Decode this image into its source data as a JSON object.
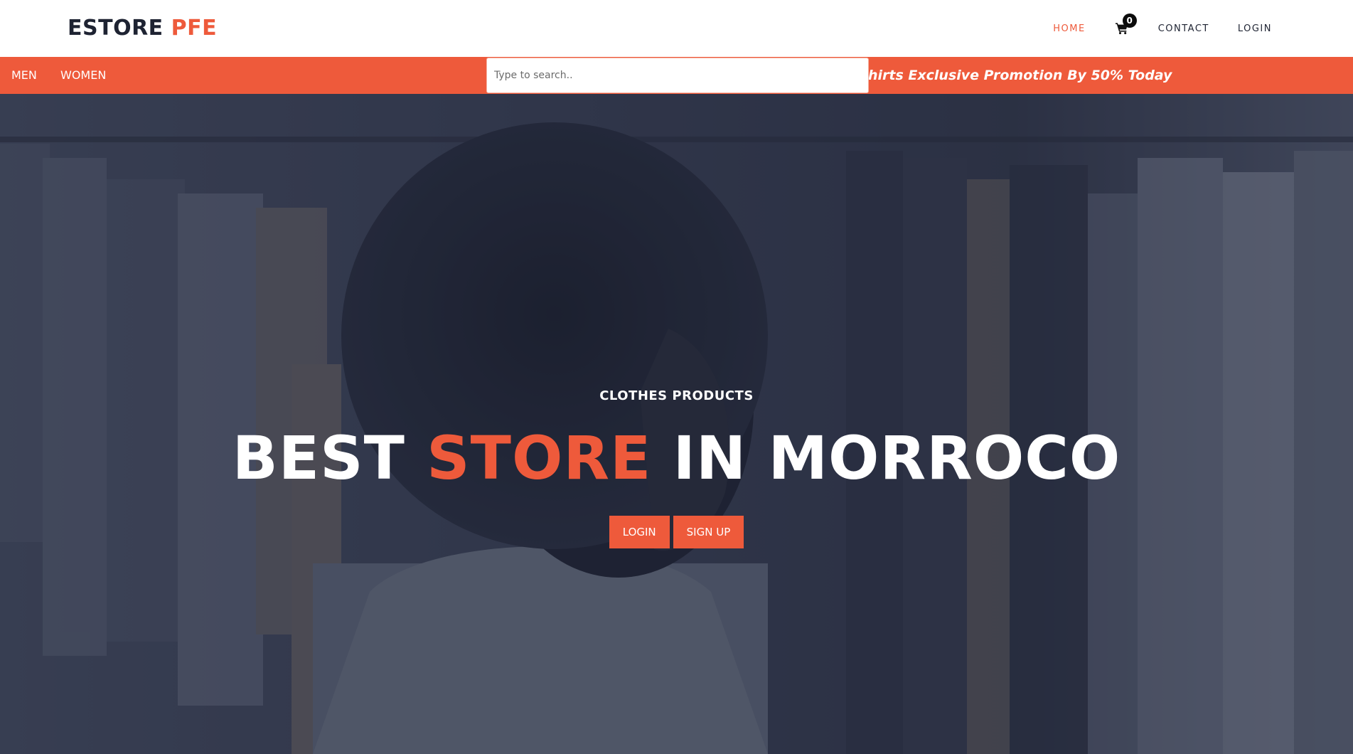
{
  "brand": {
    "name_part1": "ESTORE",
    "name_part2": "PFE",
    "accent_color": "#ee5a3b"
  },
  "nav": {
    "home": "HOME",
    "cart_icon": "shopping-cart-icon",
    "cart_count": "0",
    "contact": "CONTACT",
    "login": "LOGIN",
    "active": "home"
  },
  "categories": {
    "men": "MEN",
    "women": "WOMEN"
  },
  "search": {
    "placeholder": "Type to search.."
  },
  "promo": {
    "text": "hirts Exclusive Promotion By 50% Today"
  },
  "hero": {
    "subtitle": "CLOTHES PRODUCTS",
    "title_part1": "BEST",
    "title_part2": "STORE",
    "title_part3": "IN MORROCO",
    "login_button": "LOGIN",
    "signup_button": "SIGN UP"
  }
}
